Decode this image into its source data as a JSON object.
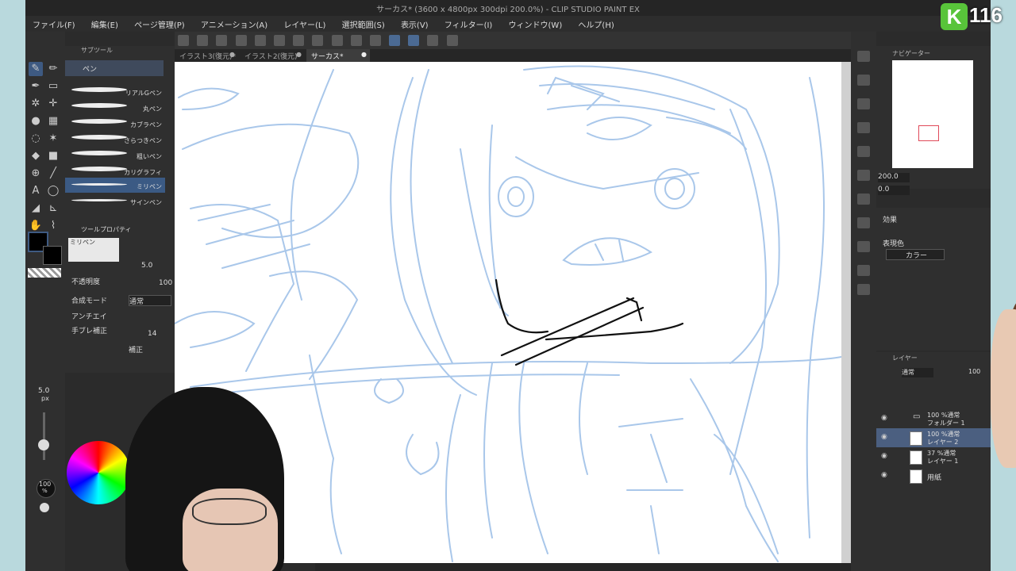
{
  "window": {
    "title": "サーカス* (3600 x 4800px 300dpi 200.0%) - CLIP STUDIO PAINT EX"
  },
  "menu": [
    "ファイル(F)",
    "編集(E)",
    "ページ管理(P)",
    "アニメーション(A)",
    "レイヤー(L)",
    "選択範囲(S)",
    "表示(V)",
    "フィルター(I)",
    "ウィンドウ(W)",
    "ヘルプ(H)"
  ],
  "tabs": [
    {
      "label": "イラスト3(復元)*"
    },
    {
      "label": "イラスト2(復元)*"
    },
    {
      "label": "サーカス*"
    }
  ],
  "subtool": {
    "header": "サブツール",
    "group": "ペン",
    "brushes": [
      "リアルGペン",
      "丸ペン",
      "カブラペン",
      "さらつきペン",
      "粗いペン",
      "カリグラフィ",
      "ミリペン",
      "サインペン"
    ],
    "selected": "ミリペン"
  },
  "tool_property": {
    "header": "ツールプロパティ",
    "tool_name": "ミリペン",
    "size_value": "5.0",
    "opacity_label": "不透明度",
    "opacity_value": "100",
    "blend_label": "合成モード",
    "blend_value": "通常",
    "antialias_label": "アンチエイ",
    "stabilize_label": "手ブレ補正",
    "stabilize_value": "14",
    "correction_label": "補正"
  },
  "brush_size": {
    "value": "5.0",
    "unit": "px"
  },
  "brush_opacity": {
    "value": "100",
    "unit": "%"
  },
  "navigator": {
    "title": "ナビゲーター",
    "zoom": "200.0",
    "rotate": "0.0"
  },
  "effect": {
    "title": "効果",
    "color_label": "表現色",
    "color_value": "カラー"
  },
  "layers": {
    "title": "レイヤー",
    "blend": "通常",
    "opacity": "100",
    "items": [
      {
        "pct": "100 %通常",
        "name": "フォルダー 1"
      },
      {
        "pct": "100 %通常",
        "name": "レイヤー 2"
      },
      {
        "pct": "37 %通常",
        "name": "レイヤー 1"
      },
      {
        "pct": "",
        "name": "用紙"
      }
    ]
  },
  "overlay": {
    "badge_letter": "K",
    "badge_number": "116"
  },
  "colors": {
    "sketch": "#a9c7ea",
    "accent": "#3e5a82",
    "ink": "#111111"
  }
}
